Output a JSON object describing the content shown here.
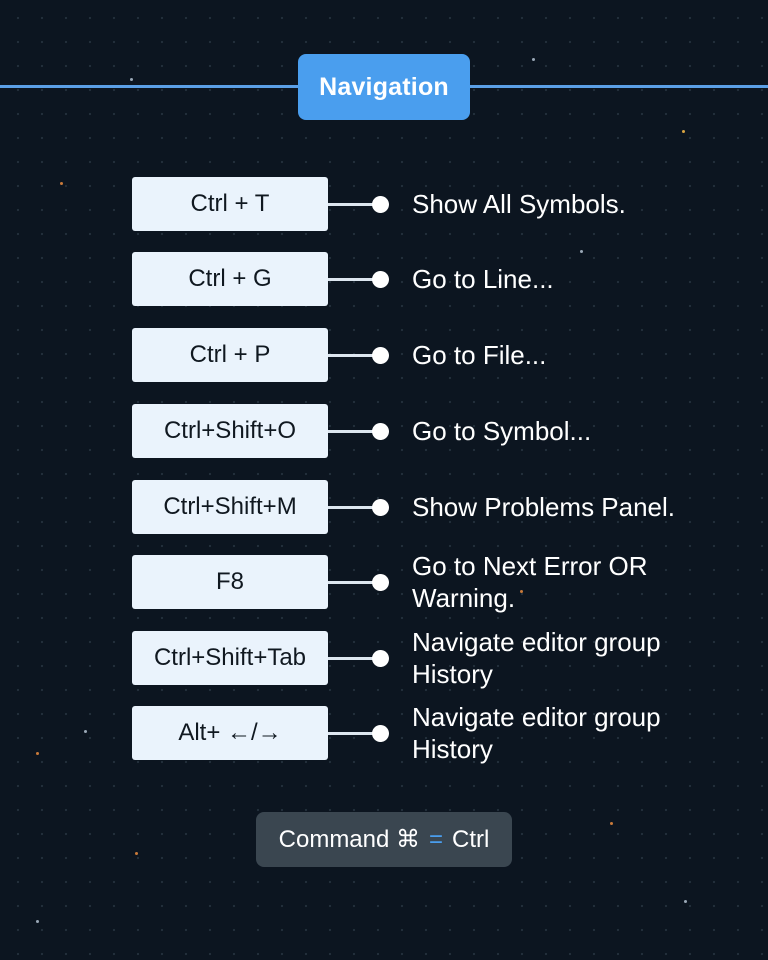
{
  "title": "Navigation",
  "shortcuts": [
    {
      "keys": "Ctrl + T",
      "description": "Show All Symbols."
    },
    {
      "keys": "Ctrl + G",
      "description": "Go to Line..."
    },
    {
      "keys": "Ctrl + P",
      "description": "Go to File..."
    },
    {
      "keys": "Ctrl+Shift+O",
      "description": "Go to Symbol..."
    },
    {
      "keys": "Ctrl+Shift+M",
      "description": "Show Problems Panel."
    },
    {
      "keys": "F8",
      "description": "Go to Next Error OR Warning."
    },
    {
      "keys": "Ctrl+Shift+Tab",
      "description": "Navigate editor group History"
    },
    {
      "keys": "Alt+ ←/→",
      "description": "Navigate editor group History"
    }
  ],
  "note": {
    "left": "Command ⌘",
    "equals": "=",
    "right": "Ctrl"
  },
  "colors": {
    "background": "#0c1520",
    "accent": "#4a9eee",
    "key_background": "#eaf3fc",
    "note_background": "#3a4650"
  }
}
